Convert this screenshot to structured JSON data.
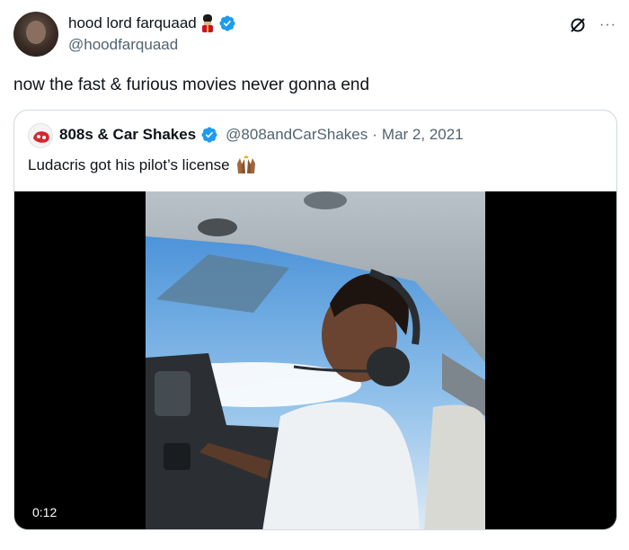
{
  "tweet": {
    "author_name": "hood lord farquaad",
    "author_handle": "@hoodfarquaad",
    "text": "now the fast & furious movies never gonna end",
    "more_label": "···"
  },
  "quoted": {
    "author_name": "808s & Car Shakes",
    "author_handle": "@808andCarShakes",
    "separator": "·",
    "date": "Mar 2, 2021",
    "text": "Ludacris got his pilot’s license",
    "video_time": "0:12"
  },
  "colors": {
    "verified": "#1d9bf0",
    "secondary_text": "#536471",
    "border": "#cfd9de"
  },
  "icons": [
    "guard-emoji-icon",
    "verified-icon",
    "grok-icon",
    "more-icon",
    "raising-hands-emoji-icon"
  ]
}
